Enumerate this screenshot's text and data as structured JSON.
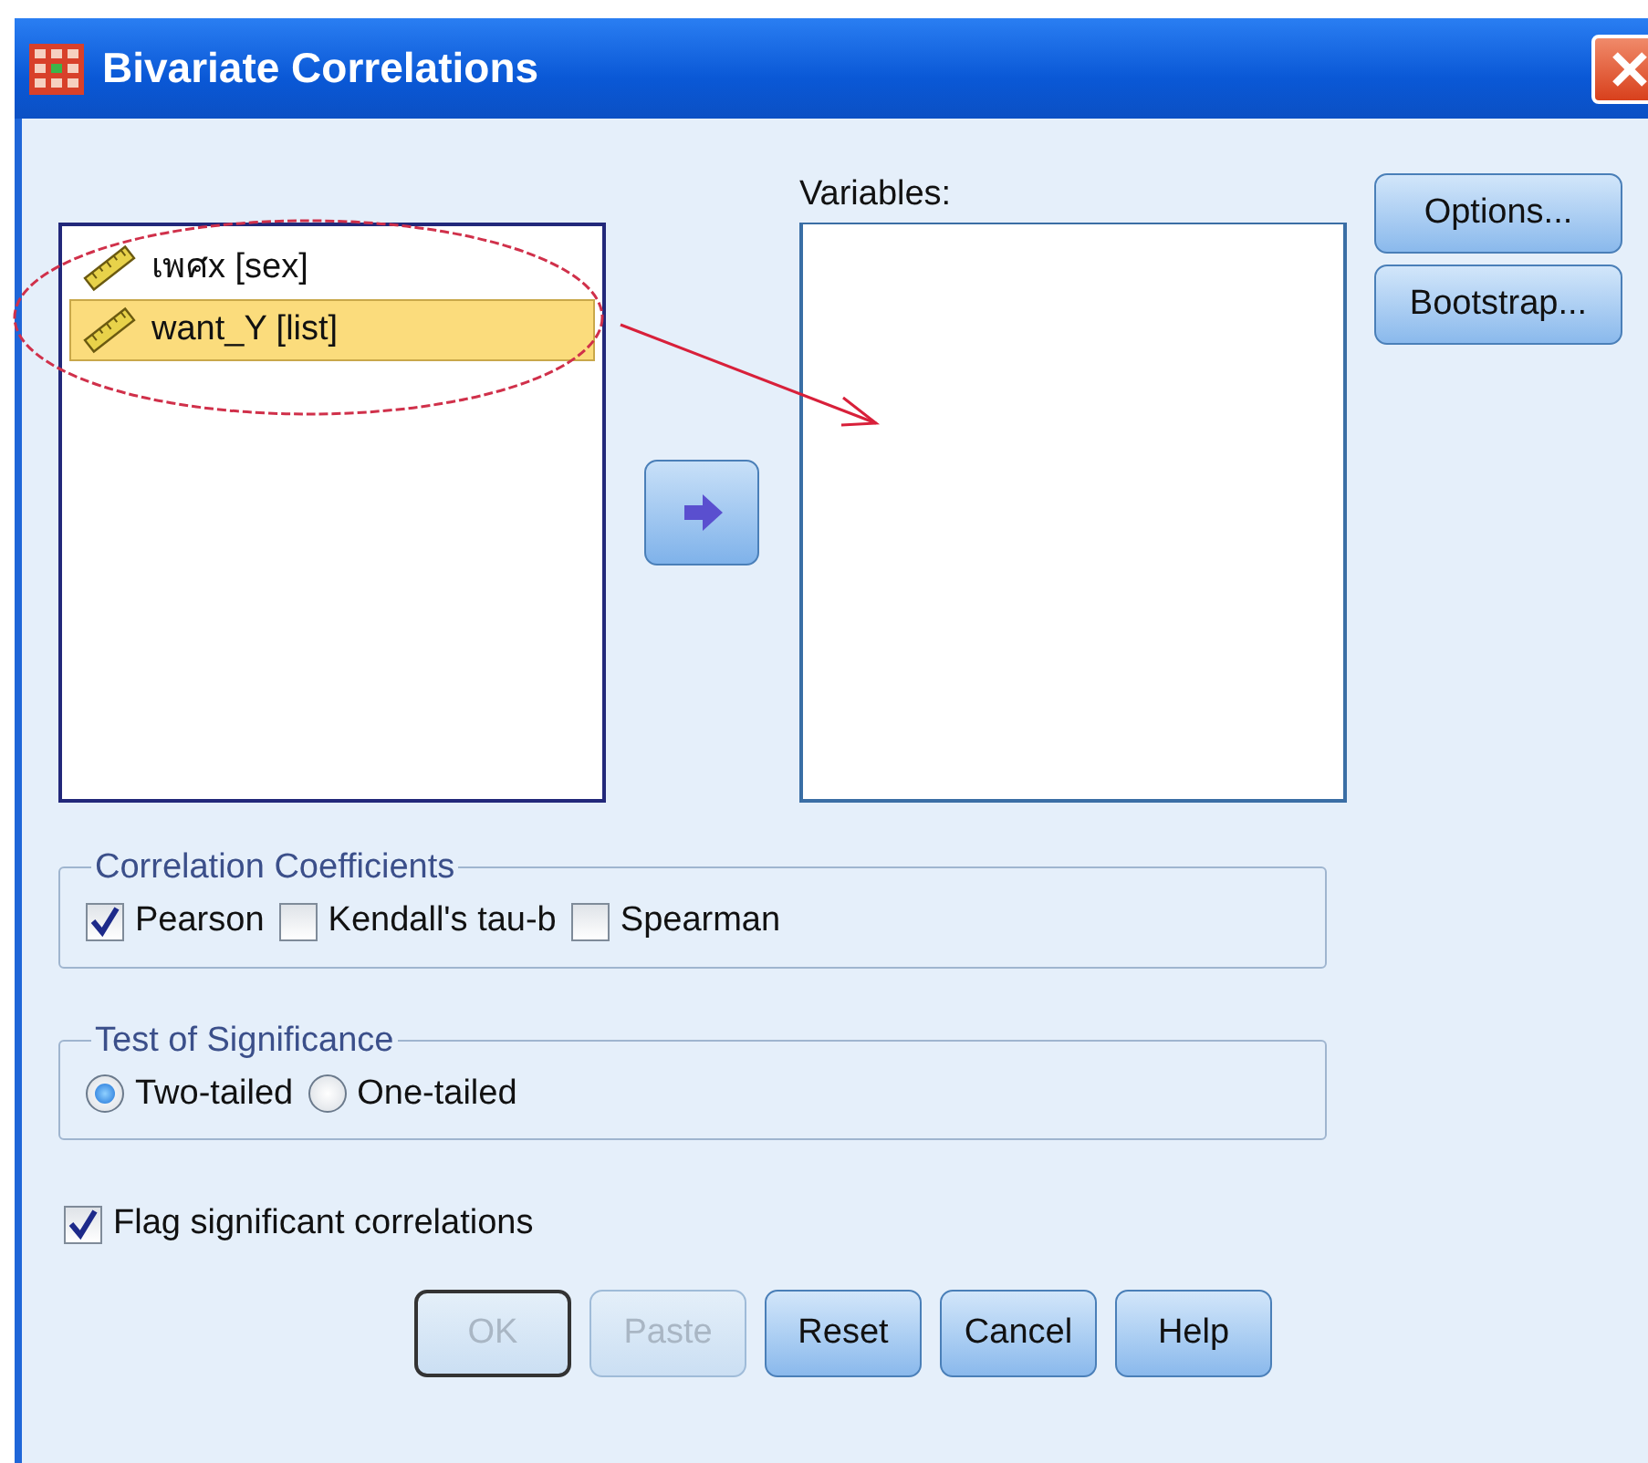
{
  "window": {
    "title": "Bivariate Correlations"
  },
  "source_list": {
    "items": [
      {
        "label": "เพศx [sex]",
        "selected": false
      },
      {
        "label": "want_Y [list]",
        "selected": true
      }
    ]
  },
  "variables": {
    "label": "Variables:"
  },
  "side_buttons": [
    {
      "label": "Options..."
    },
    {
      "label": "Bootstrap..."
    }
  ],
  "correlation_coefficients": {
    "title": "Correlation Coefficients",
    "options": [
      {
        "label": "Pearson",
        "checked": true
      },
      {
        "label": "Kendall's tau-b",
        "checked": false
      },
      {
        "label": "Spearman",
        "checked": false
      }
    ]
  },
  "test_of_significance": {
    "title": "Test of Significance",
    "options": [
      {
        "label": "Two-tailed",
        "selected": true
      },
      {
        "label": "One-tailed",
        "selected": false
      }
    ]
  },
  "flag_significant": {
    "label": "Flag significant correlations",
    "checked": true
  },
  "buttons": [
    {
      "label": "OK",
      "disabled": true,
      "default": true
    },
    {
      "label": "Paste",
      "disabled": true,
      "default": false
    },
    {
      "label": "Reset",
      "disabled": false,
      "default": false
    },
    {
      "label": "Cancel",
      "disabled": false,
      "default": false
    },
    {
      "label": "Help",
      "disabled": false,
      "default": false
    }
  ]
}
